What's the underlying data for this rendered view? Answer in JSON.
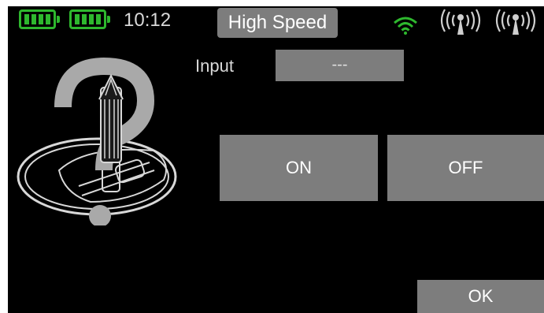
{
  "status_bar": {
    "battery_icons": [
      "battery-icon",
      "battery-icon"
    ],
    "time": "10:12",
    "mode": "High Speed",
    "icons": [
      "wifi-icon",
      "antenna-icon",
      "antenna-icon"
    ],
    "accent_color": "#2eb82e"
  },
  "input": {
    "label": "Input",
    "value": "---"
  },
  "buttons": {
    "on": "ON",
    "off": "OFF",
    "ok": "OK"
  },
  "illustration": {
    "icon": "joystick-question-icon"
  }
}
